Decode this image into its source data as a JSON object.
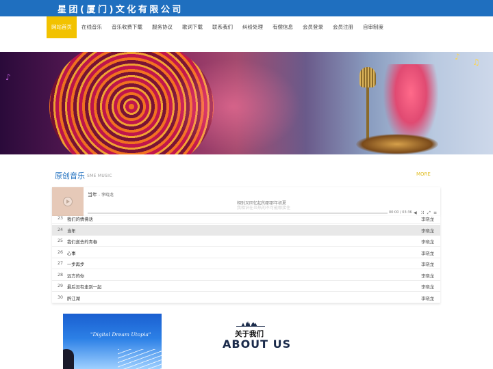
{
  "header": {
    "company_name": "星团(厦门)文化有限公司"
  },
  "nav": {
    "items": [
      {
        "label": "网站首页",
        "active": true
      },
      {
        "label": "在线音乐"
      },
      {
        "label": "音乐收费下载"
      },
      {
        "label": "服务协议"
      },
      {
        "label": "歌词下载"
      },
      {
        "label": "联系我们"
      },
      {
        "label": "纠纷处理"
      },
      {
        "label": "有偿信息"
      },
      {
        "label": "会员登录"
      },
      {
        "label": "会员注册"
      },
      {
        "label": "自审制度"
      }
    ]
  },
  "section": {
    "title": "原创音乐",
    "subtitle": "SME MUSIC",
    "more": "MORE"
  },
  "player": {
    "song": "当年",
    "artist": " - 李晓龙",
    "lyric_current": "相别又回忆起的那那年初夏",
    "lyric_next": "我相识在炎热的不可能哪接住",
    "time": "00:00 / 03:36",
    "progress": 0.0
  },
  "playlist": [
    {
      "num": "23",
      "title": "我们的情佛话",
      "artist": "李晓龙"
    },
    {
      "num": "24",
      "title": "当年",
      "artist": "李晓龙",
      "highlight": true
    },
    {
      "num": "25",
      "title": "我们逝去的青春",
      "artist": "李晓龙"
    },
    {
      "num": "26",
      "title": "心事",
      "artist": "李晓龙"
    },
    {
      "num": "27",
      "title": "一步再步",
      "artist": "李晓龙"
    },
    {
      "num": "28",
      "title": "远方的你",
      "artist": "李晓龙"
    },
    {
      "num": "29",
      "title": "最后没有走到一起",
      "artist": "李晓龙"
    },
    {
      "num": "30",
      "title": "醉江湖",
      "artist": "李晓龙"
    }
  ],
  "poster": {
    "title": "\"Digital Dream Utopia\""
  },
  "about": {
    "title_cn": "关于我们",
    "title_en": "ABOUT US"
  },
  "colors": {
    "brand_blue": "#1f6fbf",
    "nav_active": "#f2c200",
    "more": "#e2c02b"
  },
  "icons": [
    "play-icon",
    "volume-icon",
    "shuffle-icon",
    "fullscreen-icon",
    "list-icon"
  ]
}
